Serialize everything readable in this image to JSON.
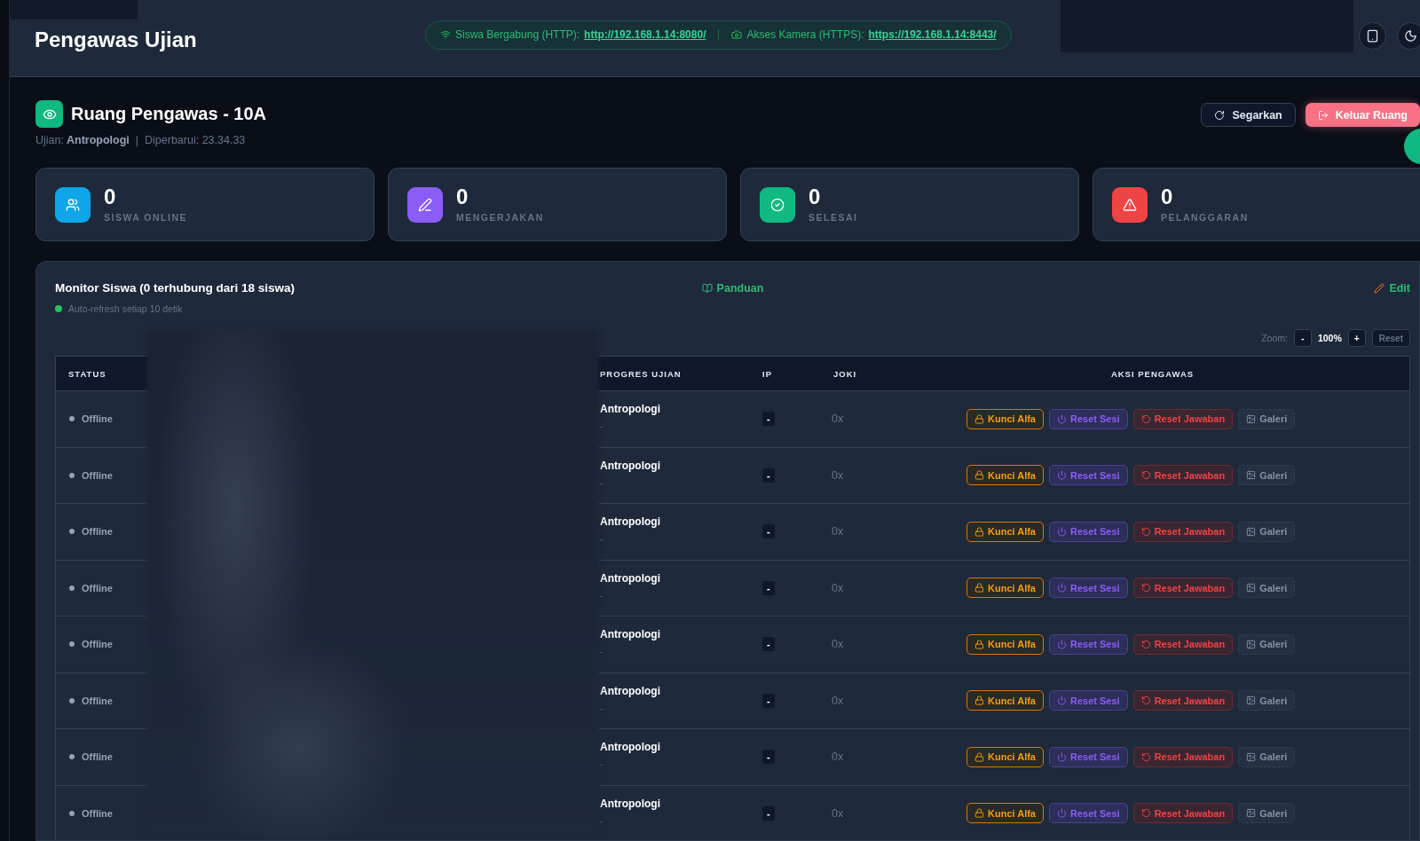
{
  "header": {
    "title": "Pengawas Ujian",
    "links": [
      {
        "kind": "wifi",
        "label": "Siswa Bergabung (HTTP):",
        "url": "http://192.168.1.14:8080/"
      },
      {
        "kind": "camera",
        "label": "Akses Kamera (HTTPS):",
        "url": "https://192.168.1.14:8443/"
      }
    ]
  },
  "room": {
    "title": "Ruang Pengawas - 10A",
    "exam_label": "Ujian:",
    "exam": "Antropologi",
    "separator": "|",
    "updated": "Diperbarui: 23.34.33",
    "buttons": [
      {
        "kind": "refresh",
        "label": "Segarkan"
      },
      {
        "kind": "exit",
        "label": "Keluar Ruang"
      }
    ]
  },
  "stats": [
    {
      "kind": "users",
      "value": "0",
      "label": "SISWA ONLINE"
    },
    {
      "kind": "edit",
      "value": "0",
      "label": "MENGERJAKAN"
    },
    {
      "kind": "done",
      "value": "0",
      "label": "SELESAI"
    },
    {
      "kind": "alert",
      "value": "0",
      "label": "PELANGGARAN"
    }
  ],
  "monitor": {
    "title": "Monitor Siswa (0 terhubung dari 18 siswa)",
    "auto_refresh": "Auto-refresh setiap 10 detik",
    "guide": "Panduan",
    "edit": "Edit",
    "zoom": {
      "label": "Zoom:",
      "minus": "-",
      "value": "100%",
      "plus": "+",
      "reset": "Reset"
    },
    "columns": [
      "STATUS",
      "PROGRES UJIAN",
      "IP",
      "JOKI",
      "AKSI PENGAWAS"
    ],
    "rows": [
      {
        "status": "Offline",
        "exam": "Antropologi",
        "progress": "-",
        "ip": "-",
        "joki": "0x",
        "actions": [
          {
            "kind": "lock",
            "label": "Kunci Alfa",
            "disabled": false
          },
          {
            "kind": "session",
            "label": "Reset Sesi",
            "disabled": false
          },
          {
            "kind": "answers",
            "label": "Reset Jawaban",
            "disabled": false
          },
          {
            "kind": "gallery",
            "label": "Galeri",
            "disabled": true
          }
        ]
      },
      {
        "status": "Offline",
        "exam": "Antropologi",
        "progress": "-",
        "ip": "-",
        "joki": "0x",
        "actions": [
          {
            "kind": "lock",
            "label": "Kunci Alfa",
            "disabled": false
          },
          {
            "kind": "session",
            "label": "Reset Sesi",
            "disabled": false
          },
          {
            "kind": "answers",
            "label": "Reset Jawaban",
            "disabled": false
          },
          {
            "kind": "gallery",
            "label": "Galeri",
            "disabled": true
          }
        ]
      },
      {
        "status": "Offline",
        "exam": "Antropologi",
        "progress": "-",
        "ip": "-",
        "joki": "0x",
        "actions": [
          {
            "kind": "lock",
            "label": "Kunci Alfa",
            "disabled": false
          },
          {
            "kind": "session",
            "label": "Reset Sesi",
            "disabled": false
          },
          {
            "kind": "answers",
            "label": "Reset Jawaban",
            "disabled": false
          },
          {
            "kind": "gallery",
            "label": "Galeri",
            "disabled": true
          }
        ]
      },
      {
        "status": "Offline",
        "exam": "Antropologi",
        "progress": "-",
        "ip": "-",
        "joki": "0x",
        "actions": [
          {
            "kind": "lock",
            "label": "Kunci Alfa",
            "disabled": false
          },
          {
            "kind": "session",
            "label": "Reset Sesi",
            "disabled": false
          },
          {
            "kind": "answers",
            "label": "Reset Jawaban",
            "disabled": false
          },
          {
            "kind": "gallery",
            "label": "Galeri",
            "disabled": true
          }
        ]
      },
      {
        "status": "Offline",
        "exam": "Antropologi",
        "progress": "-",
        "ip": "-",
        "joki": "0x",
        "actions": [
          {
            "kind": "lock",
            "label": "Kunci Alfa",
            "disabled": false
          },
          {
            "kind": "session",
            "label": "Reset Sesi",
            "disabled": false
          },
          {
            "kind": "answers",
            "label": "Reset Jawaban",
            "disabled": false
          },
          {
            "kind": "gallery",
            "label": "Galeri",
            "disabled": true
          }
        ]
      },
      {
        "status": "Offline",
        "exam": "Antropologi",
        "progress": "-",
        "ip": "-",
        "joki": "0x",
        "actions": [
          {
            "kind": "lock",
            "label": "Kunci Alfa",
            "disabled": false
          },
          {
            "kind": "session",
            "label": "Reset Sesi",
            "disabled": false
          },
          {
            "kind": "answers",
            "label": "Reset Jawaban",
            "disabled": false
          },
          {
            "kind": "gallery",
            "label": "Galeri",
            "disabled": true
          }
        ]
      },
      {
        "status": "Offline",
        "exam": "Antropologi",
        "progress": "-",
        "ip": "-",
        "joki": "0x",
        "actions": [
          {
            "kind": "lock",
            "label": "Kunci Alfa",
            "disabled": false
          },
          {
            "kind": "session",
            "label": "Reset Sesi",
            "disabled": false
          },
          {
            "kind": "answers",
            "label": "Reset Jawaban",
            "disabled": false
          },
          {
            "kind": "gallery",
            "label": "Galeri",
            "disabled": true
          }
        ]
      },
      {
        "status": "Offline",
        "exam": "Antropologi",
        "progress": "-",
        "ip": "-",
        "joki": "0x",
        "actions": [
          {
            "kind": "lock",
            "label": "Kunci Alfa",
            "disabled": false
          },
          {
            "kind": "session",
            "label": "Reset Sesi",
            "disabled": false
          },
          {
            "kind": "answers",
            "label": "Reset Jawaban",
            "disabled": false
          },
          {
            "kind": "gallery",
            "label": "Galeri",
            "disabled": true
          }
        ]
      }
    ]
  }
}
